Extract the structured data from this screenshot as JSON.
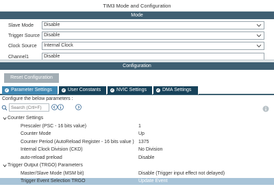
{
  "window": {
    "title": "TIM3 Mode and Configuration"
  },
  "mode": {
    "header": "Mode",
    "rows": [
      {
        "label": "Slave Mode",
        "value": "Disable"
      },
      {
        "label": "Trigger Source",
        "value": "Disable"
      },
      {
        "label": "Clock Source",
        "value": "Internal Clock"
      },
      {
        "label": "Channel1",
        "value": "Disable"
      }
    ]
  },
  "configuration": {
    "header": "Configuration",
    "reset_label": "Reset Configuration",
    "tabs": [
      {
        "label": "Parameter Settings",
        "active": true
      },
      {
        "label": "User Constants",
        "active": false
      },
      {
        "label": "NVIC Settings",
        "active": false
      },
      {
        "label": "DMA Settings",
        "active": false
      }
    ],
    "configure_text": "Configure the below parameters :",
    "search_placeholder": "Search (Crtl+F)"
  },
  "parameters": {
    "groups": [
      {
        "label": "Counter Settings",
        "items": [
          {
            "label": "Prescaler (PSC - 16 bits value)",
            "value": "1"
          },
          {
            "label": "Counter Mode",
            "value": "Up"
          },
          {
            "label": "Counter Period (AutoReload Register - 16 bits value )",
            "value": "1375"
          },
          {
            "label": "Internal Clock Division (CKD)",
            "value": "No Division"
          },
          {
            "label": "auto-reload preload",
            "value": "Disable"
          }
        ]
      },
      {
        "label": "Trigger Output (TRGO) Parameters",
        "items": [
          {
            "label": "Master/Slave Mode (MSM bit)",
            "value": "Disable (Trigger input effect not delayed)"
          },
          {
            "label": "Trigger Event Selection TRGO",
            "value": "Update Event"
          }
        ]
      }
    ]
  },
  "colors": {
    "section_header": "#3f5f72",
    "tab_active": "#3f87b2",
    "tab_inactive": "#17425a",
    "row_highlight": "#a8c4d8",
    "reset_button": "#a3aeb5"
  },
  "icons": {
    "search": "search-icon",
    "prev": "chevron-left-icon",
    "next": "chevron-right-icon",
    "info": "info-icon",
    "dropdown": "chevron-down-icon",
    "expand": "collapse-toggle-icon",
    "tab": "check-circle-icon"
  }
}
